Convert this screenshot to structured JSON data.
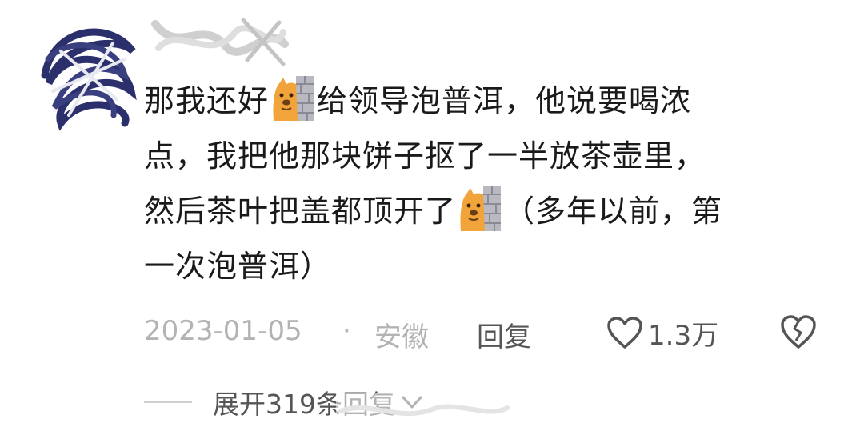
{
  "comment": {
    "line1_a": "那我还好",
    "line1_b": "给领导泡普洱，他说要喝浓",
    "line2": "点，我把他那块饼子抠了一半放茶壶里，",
    "line3_a": "然后茶叶把盖都顶开了",
    "line3_b": "（多年以前，第",
    "line4": "一次泡普洱）",
    "emoji_icon": "doge-wall-icon"
  },
  "meta": {
    "date": "2023-01-05",
    "separator": "·",
    "location": "安徽",
    "reply_label": "回复",
    "like_count": "1.3万"
  },
  "replies": {
    "expand_label": "展开319条回复"
  },
  "colors": {
    "text_primary": "#1a1a1a",
    "text_muted": "#b3b3b3",
    "text_secondary": "#555555"
  }
}
